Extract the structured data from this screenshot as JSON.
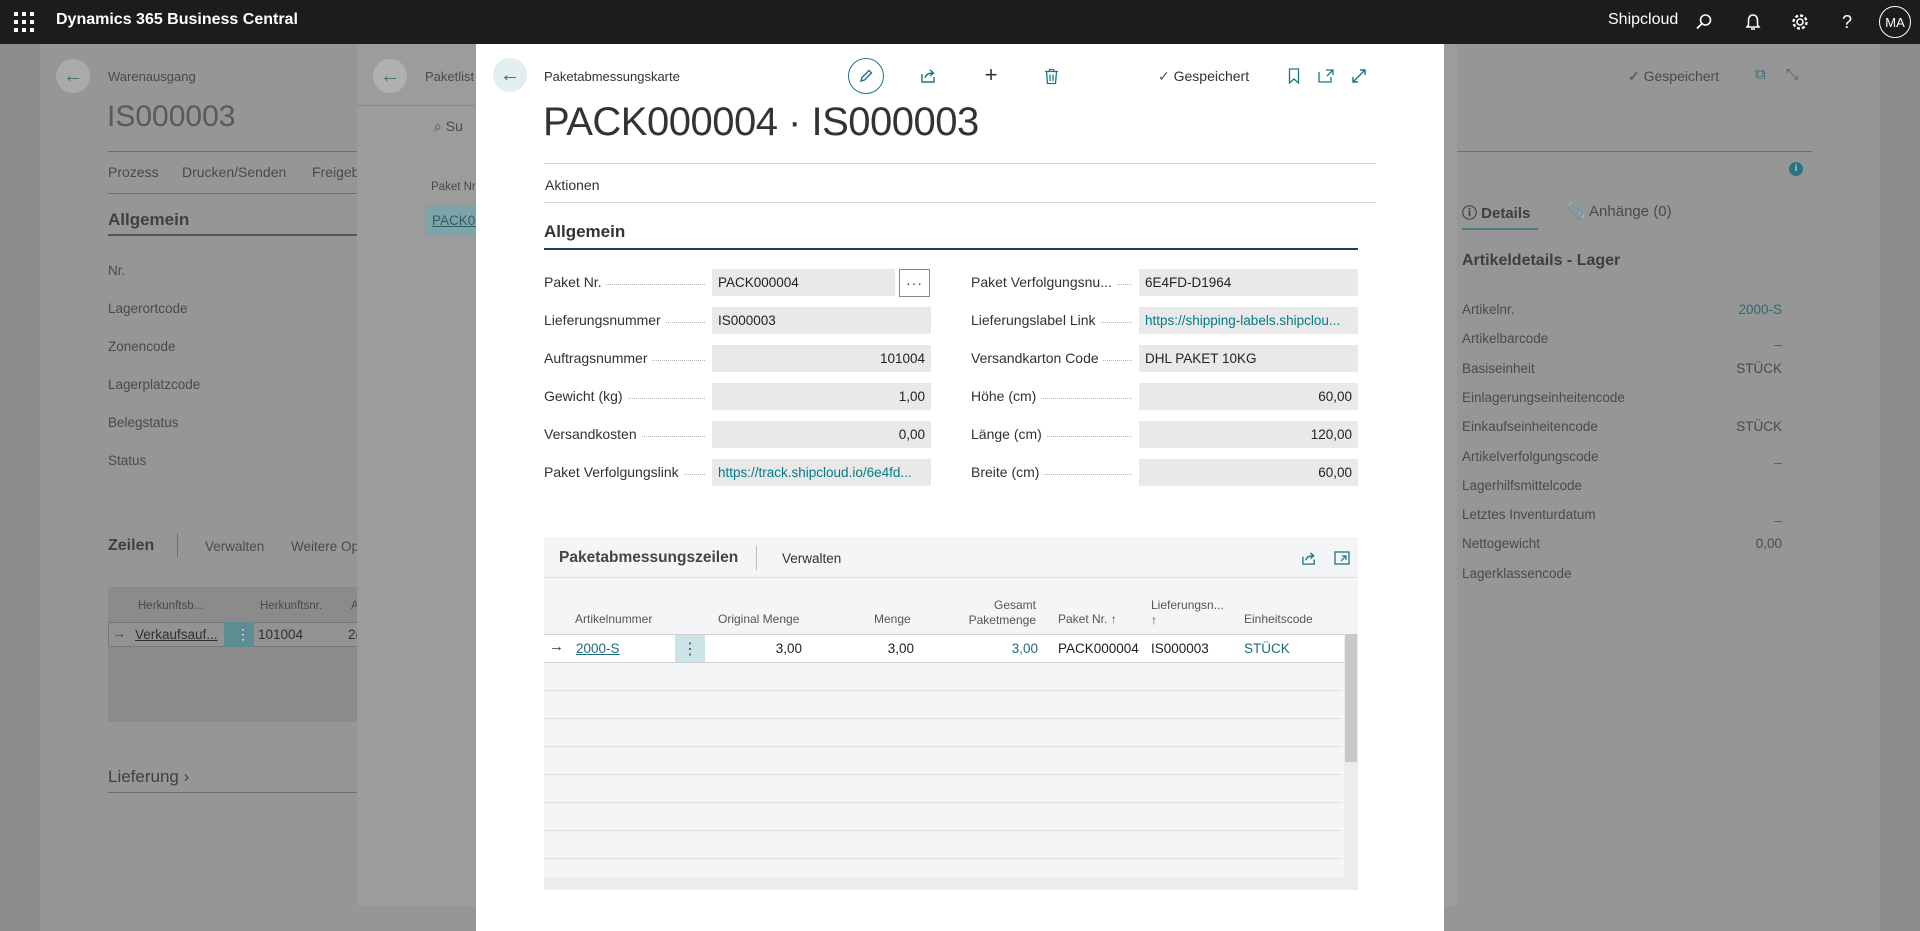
{
  "topbar": {
    "app_name": "Dynamics 365 Business Central",
    "company": "Shipcloud",
    "avatar": "MA",
    "icons": [
      "waffle-icon",
      "search-icon",
      "bell-icon",
      "gear-icon",
      "help-icon"
    ]
  },
  "bg_page": {
    "caption": "Warenausgang",
    "title": "IS000003",
    "actions": [
      "Prozess",
      "Drucken/Senden",
      "Freigeb"
    ],
    "section": "Allgemein",
    "fields": [
      "Nr.",
      "Lagerortcode",
      "Zonencode",
      "Lagerplatzcode",
      "Belegstatus",
      "Status"
    ],
    "lines_title": "Zeilen",
    "lines_actions": [
      "Verwalten",
      "Weitere Op"
    ],
    "lines_cols": [
      "Herkunftsb...",
      "Herkunftsnr.",
      "A"
    ],
    "lines_row": [
      "Verkaufsauf...",
      "101004",
      "2("
    ],
    "lieferung": "Lieferung",
    "saved": "Gespeichert"
  },
  "bg_list": {
    "caption": "Paketlist",
    "search": "Su",
    "col": "Paket Nr",
    "row": "PACK00"
  },
  "factbox": {
    "tab_details": "Details",
    "tab_attachments": "Anhänge (0)",
    "title": "Artikeldetails - Lager",
    "rows": [
      {
        "label": "Artikelnr.",
        "value": "2000-S"
      },
      {
        "label": "Artikelbarcode",
        "value": "_"
      },
      {
        "label": "Basiseinheit",
        "value": "STÜCK"
      },
      {
        "label": "Einlagerungseinheitencode",
        "value": ""
      },
      {
        "label": "Einkaufseinheitencode",
        "value": "STÜCK"
      },
      {
        "label": "Artikelverfolgungscode",
        "value": "_"
      },
      {
        "label": "Lagerhilfsmittelcode",
        "value": ""
      },
      {
        "label": "Letztes Inventurdatum",
        "value": "_"
      },
      {
        "label": "Nettogewicht",
        "value": "0,00"
      },
      {
        "label": "Lagerklassencode",
        "value": ""
      }
    ]
  },
  "card": {
    "caption": "Paketabmessungskarte",
    "title": "PACK000004 · IS000003",
    "saved": "Gespeichert",
    "actions_label": "Aktionen",
    "section": "Allgemein",
    "left_fields": [
      {
        "label": "Paket Nr.",
        "value": "PACK000004"
      },
      {
        "label": "Lieferungsnummer",
        "value": "IS000003"
      },
      {
        "label": "Auftragsnummer",
        "value": "101004"
      },
      {
        "label": "Gewicht (kg)",
        "value": "1,00"
      },
      {
        "label": "Versandkosten",
        "value": "0,00"
      },
      {
        "label": "Paket Verfolgungslink",
        "value": "https://track.shipcloud.io/6e4fd..."
      }
    ],
    "right_fields": [
      {
        "label": "Paket Verfolgungsnu...",
        "value": "6E4FD-D1964"
      },
      {
        "label": "Lieferungslabel Link",
        "value": "https://shipping-labels.shipclou..."
      },
      {
        "label": "Versandkarton Code",
        "value": "DHL PAKET 10KG"
      },
      {
        "label": "Höhe (cm)",
        "value": "60,00"
      },
      {
        "label": "Länge (cm)",
        "value": "120,00"
      },
      {
        "label": "Breite (cm)",
        "value": "60,00"
      }
    ],
    "lines": {
      "title": "Paketabmessungszeilen",
      "manage": "Verwalten",
      "headers": {
        "item": "Artikelnummer",
        "orig_qty": "Original Menge",
        "qty": "Menge",
        "total1": "Gesamt",
        "total2": "Paketmenge",
        "pkg": "Paket Nr. ↑",
        "ship1": "Lieferungsn...",
        "ship2": "↑",
        "unit": "Einheitscode"
      },
      "row": {
        "item": "2000-S",
        "orig_qty": "3,00",
        "qty": "3,00",
        "total": "3,00",
        "pkg": "PACK000004",
        "ship": "IS000003",
        "unit": "STÜCK"
      }
    }
  }
}
